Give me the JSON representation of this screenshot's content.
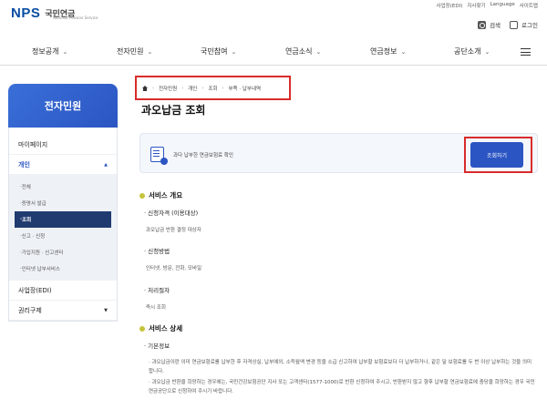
{
  "header": {
    "logo": "NPS",
    "logo_kor": "국민연금",
    "logo_sub": "National Pension Service",
    "util_links": [
      "사업장(EDI)",
      "지사찾기",
      "Language",
      "사이트맵"
    ],
    "search_label": "검색",
    "login_label": "로그인"
  },
  "gnb": {
    "items": [
      "정보공개",
      "전자민원",
      "국민참여",
      "연금소식",
      "연금정보",
      "공단소개"
    ]
  },
  "sidebar": {
    "title": "전자민원",
    "items": [
      {
        "label": "마이페이지"
      },
      {
        "label": "개인"
      },
      {
        "label": "사업장(EDI)"
      },
      {
        "label": "권리구제"
      }
    ],
    "sub_items": [
      "전체",
      "증명서 발급",
      "조회",
      "신고 · 신청",
      "가입지원 · 신고센터",
      "인터넷 납부서비스"
    ]
  },
  "breadcrumb": [
    "전자민원",
    "개인",
    "조회",
    "부족 · 납부내역"
  ],
  "page": {
    "title": "과오납금 조회",
    "notice_text": "과다 납부한 연금보험료 확인",
    "lookup_button": "조회하기"
  },
  "service_overview": {
    "heading": "서비스 개요",
    "eligibility_label": "신청자격 (이용대상)",
    "eligibility_value": "과오납금 반환 결정 대상자",
    "method_label": "신청방법",
    "method_value": "인터넷, 방문, 전화, 모바일",
    "procedure_label": "처리절차",
    "procedure_value": "즉시 조회"
  },
  "service_detail": {
    "heading": "서비스 상세",
    "basic_label": "기본정보",
    "paragraph1": "· 과오납금이란 이미 연금보험료를 납부한 후 자격상실, 납부예외, 소득월액 변경 등을 소급 신고하여 납부할 보험료보다 더 납부하거나, 같은 달 보험료를 두 번 이상 납부하는 것을 의미합니다.",
    "paragraph2": "· 과오납금 반환을 희망하는 경우에는, 국민건강보험공단 지사 또는 고객센터(1577-1000)로 반환 신청하여 주시고, 반환받지 않고 향후 납부할 연금보험료에 충당을 희망하는 경우 국민연금공단으로 신청하여 주시기 바랍니다."
  }
}
